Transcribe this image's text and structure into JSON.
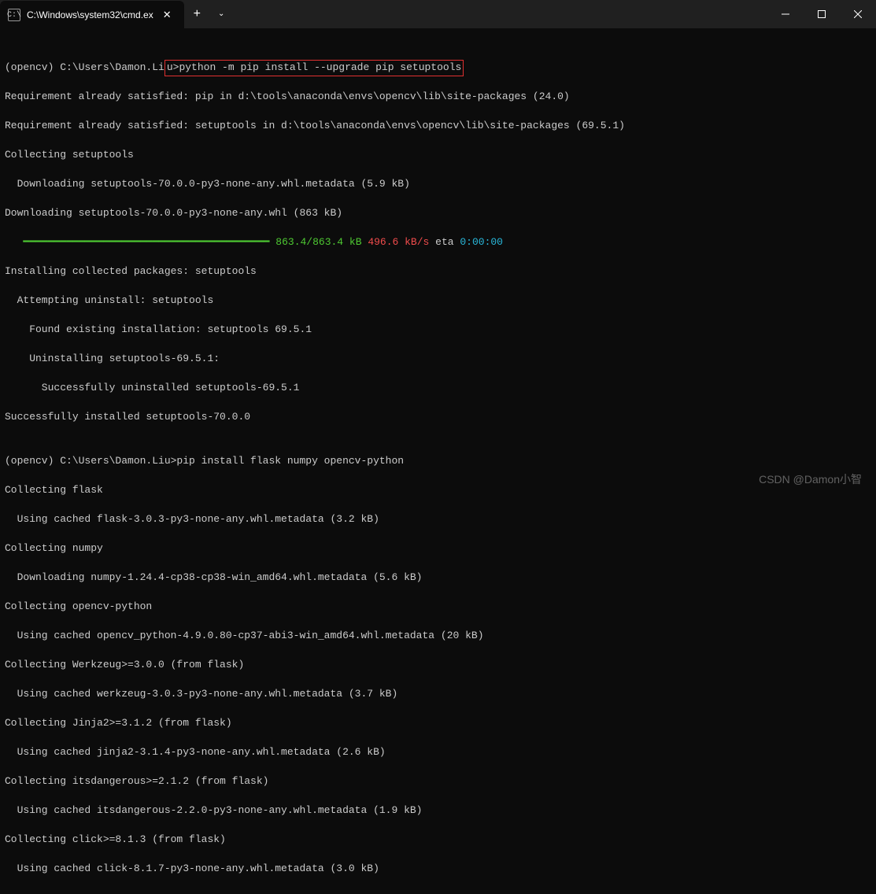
{
  "window": {
    "tab_title": "C:\\Windows\\system32\\cmd.ex",
    "tab_icon_char": "C:\\",
    "close_icon": "✕",
    "newtab": "+",
    "dropdown": "⌄",
    "min": "─",
    "max": "□",
    "winclose": "✕"
  },
  "prompt1_prefix": "(opencv) C:\\Users\\Damon.Li",
  "prompt1_boxed": "u>python -m pip install --upgrade pip setuptools",
  "lines": {
    "l1": "Requirement already satisfied: pip in d:\\tools\\anaconda\\envs\\opencv\\lib\\site-packages (24.0)",
    "l2": "Requirement already satisfied: setuptools in d:\\tools\\anaconda\\envs\\opencv\\lib\\site-packages (69.5.1)",
    "l3": "Collecting setuptools",
    "l4": "  Downloading setuptools-70.0.0-py3-none-any.whl.metadata (5.9 kB)",
    "l5": "Downloading setuptools-70.0.0-py3-none-any.whl (863 kB)",
    "pb_bar": "   ━━━━━━━━━━━━━━━━━━━━━━━━━━━━━━━━━━━━━━━━",
    "pb_size": " 863.4/863.4 kB",
    "pb_speed": " 496.6 kB/s",
    "pb_eta_lbl": " eta ",
    "pb_eta": "0:00:00",
    "l7": "Installing collected packages: setuptools",
    "l8": "  Attempting uninstall: setuptools",
    "l9": "    Found existing installation: setuptools 69.5.1",
    "l10": "    Uninstalling setuptools-69.5.1:",
    "l11": "      Successfully uninstalled setuptools-69.5.1",
    "l12": "Successfully installed setuptools-70.0.0",
    "blank": "",
    "prompt2": "(opencv) C:\\Users\\Damon.Liu>pip install flask numpy opencv-python",
    "l14": "Collecting flask",
    "l15": "  Using cached flask-3.0.3-py3-none-any.whl.metadata (3.2 kB)",
    "l16": "Collecting numpy",
    "l17": "  Downloading numpy-1.24.4-cp38-cp38-win_amd64.whl.metadata (5.6 kB)",
    "l18": "Collecting opencv-python",
    "l19": "  Using cached opencv_python-4.9.0.80-cp37-abi3-win_amd64.whl.metadata (20 kB)",
    "l20": "Collecting Werkzeug>=3.0.0 (from flask)",
    "l21": "  Using cached werkzeug-3.0.3-py3-none-any.whl.metadata (3.7 kB)",
    "l22": "Collecting Jinja2>=3.1.2 (from flask)",
    "l23": "  Using cached jinja2-3.1.4-py3-none-any.whl.metadata (2.6 kB)",
    "l24": "Collecting itsdangerous>=2.1.2 (from flask)",
    "l25": "  Using cached itsdangerous-2.2.0-py3-none-any.whl.metadata (1.9 kB)",
    "l26": "Collecting click>=8.1.3 (from flask)",
    "l27": "  Using cached click-8.1.7-py3-none-any.whl.metadata (3.0 kB)"
  },
  "watermark": "CSDN @Damon小智"
}
